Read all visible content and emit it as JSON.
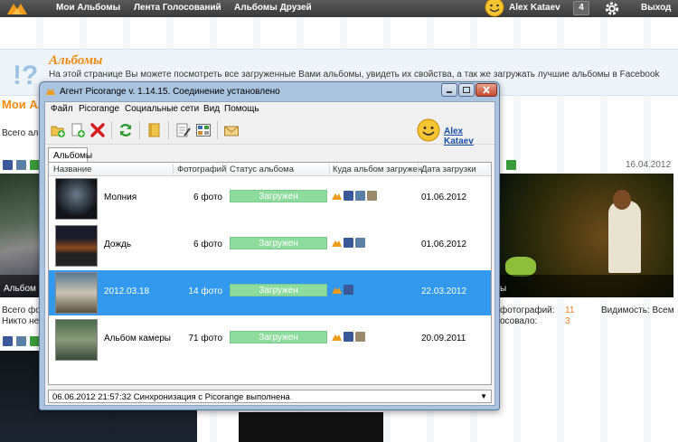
{
  "topbar": {
    "nav": [
      "Мои Альбомы",
      "Лента Голосований",
      "Альбомы Друзей"
    ],
    "user_name": "Alex Kataev",
    "badge": "4",
    "exit": "Выход"
  },
  "infobox": {
    "title": "Альбомы",
    "desc": "На этой странице Вы можете посмотреть все загруженные Вами альбомы, увидеть их свойства, а так же загружать лучшие альбомы в Facebook"
  },
  "background": {
    "heading": "Мои Ал",
    "total": "Всего аль",
    "date": "16.04.2012",
    "photo_caption": "Альбом",
    "caption_right": "ы",
    "left_line1": "Всего фо",
    "left_line2": "Никто не",
    "photos_label": "фотографий:",
    "photos_value": "11",
    "voted_label": "осовало:",
    "voted_value": "3",
    "visibility": "Видимость: Всем"
  },
  "window": {
    "title": "Агент Picorange v. 1.14.15. Соединение установлено",
    "menu": [
      "Файл",
      "Picorange",
      "Социальные сети",
      "Вид",
      "Помощь"
    ],
    "user_link": "Alex Kataev",
    "tab": "Альбомы",
    "columns": [
      "Название",
      "Фотографий",
      "Статус альбома",
      "Куда альбом загружен",
      "Дата загрузки"
    ],
    "rows": [
      {
        "name": "Молния",
        "count": "6 фото",
        "status": "Загружен",
        "date": "01.06.2012",
        "targets": [
          "picorange",
          "facebook",
          "vkontakte",
          "odnoklassniki"
        ],
        "selected": false
      },
      {
        "name": "Дождь",
        "count": "6 фото",
        "status": "Загружен",
        "date": "01.06.2012",
        "targets": [
          "picorange",
          "facebook",
          "vkontakte"
        ],
        "selected": false
      },
      {
        "name": "2012.03.18",
        "count": "14 фото",
        "status": "Загружен",
        "date": "22.03.2012",
        "targets": [
          "picorange",
          "facebook"
        ],
        "selected": true
      },
      {
        "name": "Альбом камеры",
        "count": "71 фото",
        "status": "Загружен",
        "date": "20.09.2011",
        "targets": [
          "picorange",
          "facebook",
          "odnoklassniki"
        ],
        "selected": false
      }
    ],
    "status": "06.06.2012 21:57:32 Синхронизация с Picorange выполнена"
  },
  "colors": {
    "accent": "#f08a10",
    "selection": "#3399ee",
    "status_green": "#8edb9e",
    "facebook": "#3b5998",
    "vkontakte": "#5b7fa6",
    "odnoklassniki": "#ee8208"
  },
  "icons": [
    "picorange-logo",
    "smiley-avatar",
    "gear-icon",
    "question-icon",
    "add-album-icon",
    "add-photo-icon",
    "delete-icon",
    "refresh-icon",
    "folder-icon",
    "edit-icon",
    "view-icon",
    "envelope-icon"
  ]
}
